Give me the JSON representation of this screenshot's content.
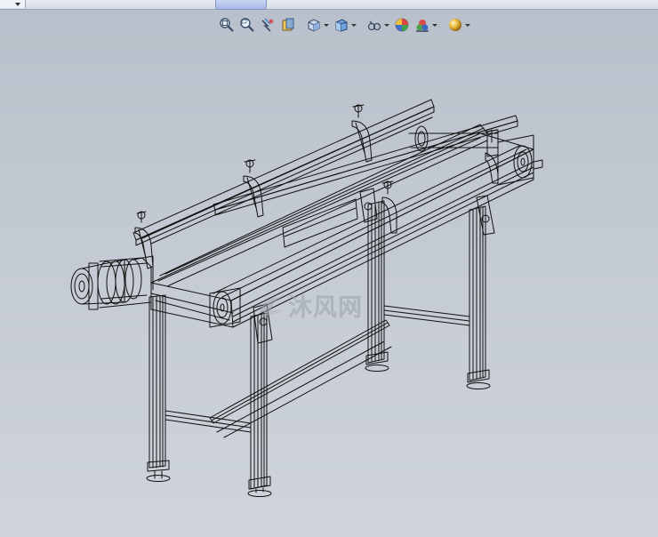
{
  "window": {
    "top_strip": {
      "dropdown_icon": "chevron-down-icon"
    }
  },
  "heads_up_toolbar": {
    "buttons": [
      {
        "icon": "zoom-to-fit-icon",
        "dropdown": false
      },
      {
        "icon": "zoom-to-area-icon",
        "dropdown": false
      },
      {
        "icon": "previous-view-icon",
        "dropdown": false
      },
      {
        "icon": "section-view-icon",
        "dropdown": false
      },
      {
        "icon": "view-orientation-icon",
        "dropdown": true
      },
      {
        "icon": "display-style-icon",
        "dropdown": true
      },
      {
        "icon": "hide-show-items-icon",
        "dropdown": true
      },
      {
        "icon": "edit-appearance-icon",
        "dropdown": false
      },
      {
        "icon": "apply-scene-icon",
        "dropdown": true
      },
      {
        "icon": "view-settings-icon",
        "dropdown": true
      }
    ]
  },
  "graphics_area": {
    "model": "belt-conveyor-wireframe",
    "display_style": "wireframe",
    "background": [
      "#b8c0cb",
      "#cfd4db"
    ],
    "watermark": {
      "icon": "logo-icon",
      "text": "沐风网"
    }
  },
  "colors": {
    "wire": "#111111",
    "accent": "#7d8fc3"
  }
}
